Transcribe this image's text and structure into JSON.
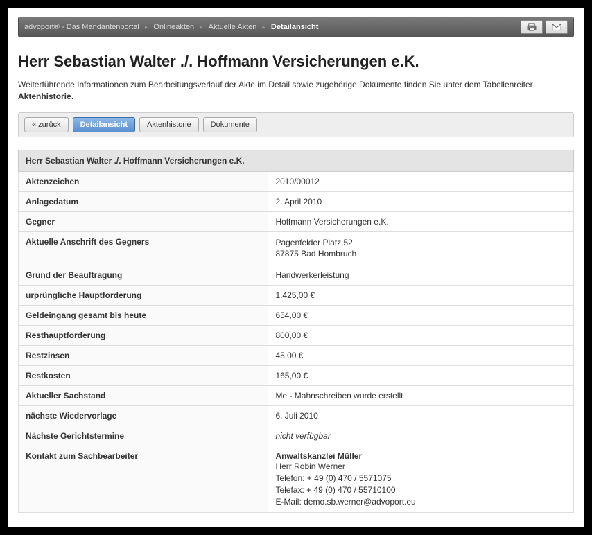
{
  "breadcrumbs": {
    "items": [
      {
        "label": "advoport® - Das Mandantenportal"
      },
      {
        "label": "Onlineakten"
      },
      {
        "label": "Aktuelle Akten"
      },
      {
        "label": "Detailansicht",
        "active": true
      }
    ]
  },
  "title": "Herr Sebastian Walter ./. Hoffmann Versicherungen e.K.",
  "intro_prefix": "Weiterführende Informationen zum Bearbeitungsverlauf der Akte im Detail sowie zugehörige Dokumente finden Sie unter dem Tabellenreiter ",
  "intro_bold": "Aktenhistorie",
  "intro_suffix": ".",
  "tabs": {
    "back": "« zurück",
    "detail": "Detailansicht",
    "history": "Aktenhistorie",
    "docs": "Dokumente"
  },
  "table_header": "Herr Sebastian Walter ./. Hoffmann Versicherungen e.K.",
  "rows": {
    "aktenzeichen_l": "Aktenzeichen",
    "aktenzeichen_v": "2010/00012",
    "anlagedatum_l": "Anlagedatum",
    "anlagedatum_v": "2. April 2010",
    "gegner_l": "Gegner",
    "gegner_v": "Hoffmann Versicherungen e.K.",
    "anschrift_l": "Aktuelle Anschrift des Gegners",
    "anschrift_v": "Pagenfelder Platz 52\n87875 Bad Hombruch",
    "grund_l": "Grund der Beauftragung",
    "grund_v": "Handwerkerleistung",
    "urhaupt_l": "urprüngliche Hauptforderung",
    "urhaupt_v": "1.425,00 €",
    "geldeingang_l": "Geldeingang gesamt bis heute",
    "geldeingang_v": "654,00 €",
    "resthaupt_l": "Resthauptforderung",
    "resthaupt_v": "800,00 €",
    "restzinsen_l": "Restzinsen",
    "restzinsen_v": "45,00 €",
    "restkosten_l": "Restkosten",
    "restkosten_v": "165,00 €",
    "sachstand_l": "Aktueller Sachstand",
    "sachstand_v": "Me - Mahnschreiben wurde erstellt",
    "wiedervorlage_l": "nächste Wiedervorlage",
    "wiedervorlage_v": "6. Juli 2010",
    "gericht_l": "Nächste Gerichtstermine",
    "gericht_v": "nicht verfügbar",
    "kontakt_l": "Kontakt zum Sachbearbeiter",
    "kontakt_firm": "Anwaltskanzlei Müller",
    "kontakt_rest": "Herr Robin Werner\nTelefon: + 49 (0) 470 / 5571075\nTelefax: + 49 (0) 470 / 55710100\nE-Mail: demo.sb.werner@advoport.eu"
  }
}
